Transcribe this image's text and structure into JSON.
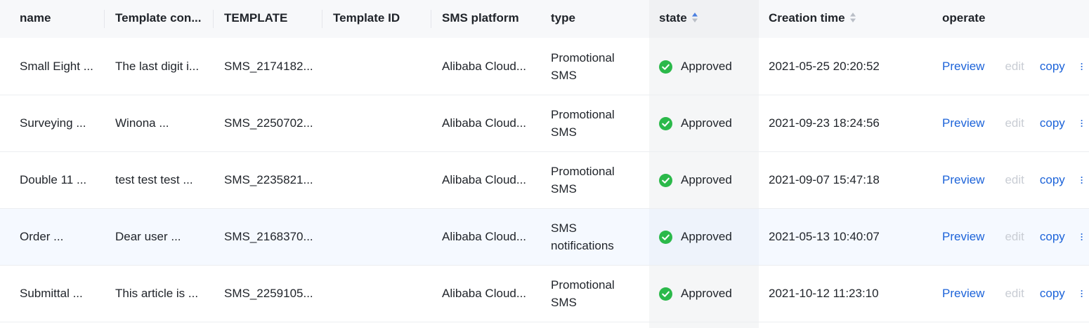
{
  "columns": {
    "name": "name",
    "template_content": "Template con...",
    "template": "TEMPLATE",
    "template_id": "Template ID",
    "sms_platform": "SMS platform",
    "type": "type",
    "state": "state",
    "creation_time": "Creation time",
    "operate": "operate"
  },
  "actions": {
    "preview": "Preview",
    "edit": "edit",
    "copy": "copy"
  },
  "colors": {
    "link": "#1c63d9",
    "approved": "#2bb94a",
    "disabled": "#c9cdd4",
    "sort_active": "#4a7fe0"
  },
  "rows": [
    {
      "name": "Small Eight ...",
      "template_content": "The last digit i...",
      "template": "SMS_2174182...",
      "template_id": "",
      "sms_platform": "Alibaba Cloud...",
      "type_line1": "Promotional",
      "type_line2": "SMS",
      "state": "Approved",
      "creation_time": "2021-05-25 20:20:52"
    },
    {
      "name": "Surveying ...",
      "template_content": "Winona ...",
      "template": "SMS_2250702...",
      "template_id": "",
      "sms_platform": "Alibaba Cloud...",
      "type_line1": "Promotional",
      "type_line2": "SMS",
      "state": "Approved",
      "creation_time": "2021-09-23 18:24:56"
    },
    {
      "name": "Double 11 ...",
      "template_content": "test test test ...",
      "template": "SMS_2235821...",
      "template_id": "",
      "sms_platform": "Alibaba Cloud...",
      "type_line1": "Promotional",
      "type_line2": "SMS",
      "state": "Approved",
      "creation_time": "2021-09-07 15:47:18"
    },
    {
      "name": "Order ...",
      "template_content": "Dear user ...",
      "template": "SMS_2168370...",
      "template_id": "",
      "sms_platform": "Alibaba Cloud...",
      "type_line1": "SMS",
      "type_line2": "notifications",
      "state": "Approved",
      "creation_time": "2021-05-13 10:40:07"
    },
    {
      "name": "Submittal ...",
      "template_content": "This article is ...",
      "template": "SMS_2259105...",
      "template_id": "",
      "sms_platform": "Alibaba Cloud...",
      "type_line1": "Promotional",
      "type_line2": "SMS",
      "state": "Approved",
      "creation_time": "2021-10-12 11:23:10"
    }
  ]
}
